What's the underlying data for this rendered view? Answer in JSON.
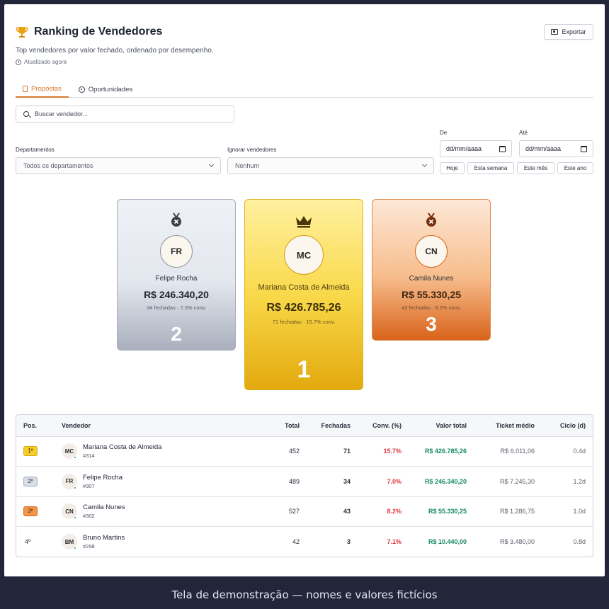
{
  "header": {
    "title": "Ranking de Vendedores",
    "subtitle": "Top vendedores por valor fechado, ordenado por desempenho.",
    "updated": "Atualizado agora",
    "export_label": "Exportar"
  },
  "tabs": [
    {
      "label": "Propostas",
      "active": true
    },
    {
      "label": "Oportunidades",
      "active": false
    }
  ],
  "search": {
    "placeholder": "Buscar vendedor..."
  },
  "filters": {
    "departments_label": "Departamentos",
    "departments_value": "Todos os departamentos",
    "ignore_label": "Ignorar vendedores",
    "ignore_value": "Nenhum",
    "from_label": "De",
    "from_value": "dd/mm/aaaa",
    "to_label": "Até",
    "to_value": "dd/mm/aaaa",
    "quick": [
      "Hoje",
      "Esta semana",
      "Este mês",
      "Este ano"
    ]
  },
  "podium": {
    "first": {
      "initials": "MC",
      "name": "Mariana Costa de Almeida",
      "value": "R$ 426.785,26",
      "meta": "71 fechadas · 15.7% conv.",
      "rank": "1"
    },
    "second": {
      "initials": "FR",
      "name": "Felipe Rocha",
      "value": "R$ 246.340,20",
      "meta": "34 fechadas · 7.0% conv.",
      "rank": "2"
    },
    "third": {
      "initials": "CN",
      "name": "Camila Nunes",
      "value": "R$ 55.330,25",
      "meta": "43 fechadas · 8.2% conv.",
      "rank": "3"
    }
  },
  "table": {
    "headers": [
      "Pos.",
      "Vendedor",
      "Total",
      "Fechadas",
      "Conv. (%)",
      "Valor total",
      "Ticket médio",
      "Ciclo (d)"
    ],
    "rows": [
      {
        "pos": "1º",
        "initials": "MC",
        "name": "Mariana Costa de Almeida",
        "id": "#314",
        "total": "452",
        "closed": "71",
        "conv": "15.7%",
        "value": "R$ 426.785,26",
        "ticket": "R$ 6.011,06",
        "cycle": "0.4d"
      },
      {
        "pos": "2º",
        "initials": "FR",
        "name": "Felipe Rocha",
        "id": "#307",
        "total": "489",
        "closed": "34",
        "conv": "7.0%",
        "value": "R$ 246.340,20",
        "ticket": "R$ 7.245,30",
        "cycle": "1.2d"
      },
      {
        "pos": "3º",
        "initials": "CN",
        "name": "Camila Nunes",
        "id": "#302",
        "total": "527",
        "closed": "43",
        "conv": "8.2%",
        "value": "R$ 55.330,25",
        "ticket": "R$ 1.286,75",
        "cycle": "1.0d"
      },
      {
        "pos": "4º",
        "initials": "BM",
        "name": "Bruno Martins",
        "id": "#298",
        "total": "42",
        "closed": "3",
        "conv": "7.1%",
        "value": "R$ 10.440,00",
        "ticket": "R$ 3.480,00",
        "cycle": "0.8d"
      }
    ]
  },
  "footer": {
    "caption": "Tela de demonstração — nomes e valores fictícios"
  },
  "colors": {
    "accent": "#d9782a",
    "gold": "#f6cd2a",
    "silver": "#d8dde6",
    "bronze": "#f2964c",
    "positive": "#158a5c",
    "conv": "#e0383f"
  }
}
